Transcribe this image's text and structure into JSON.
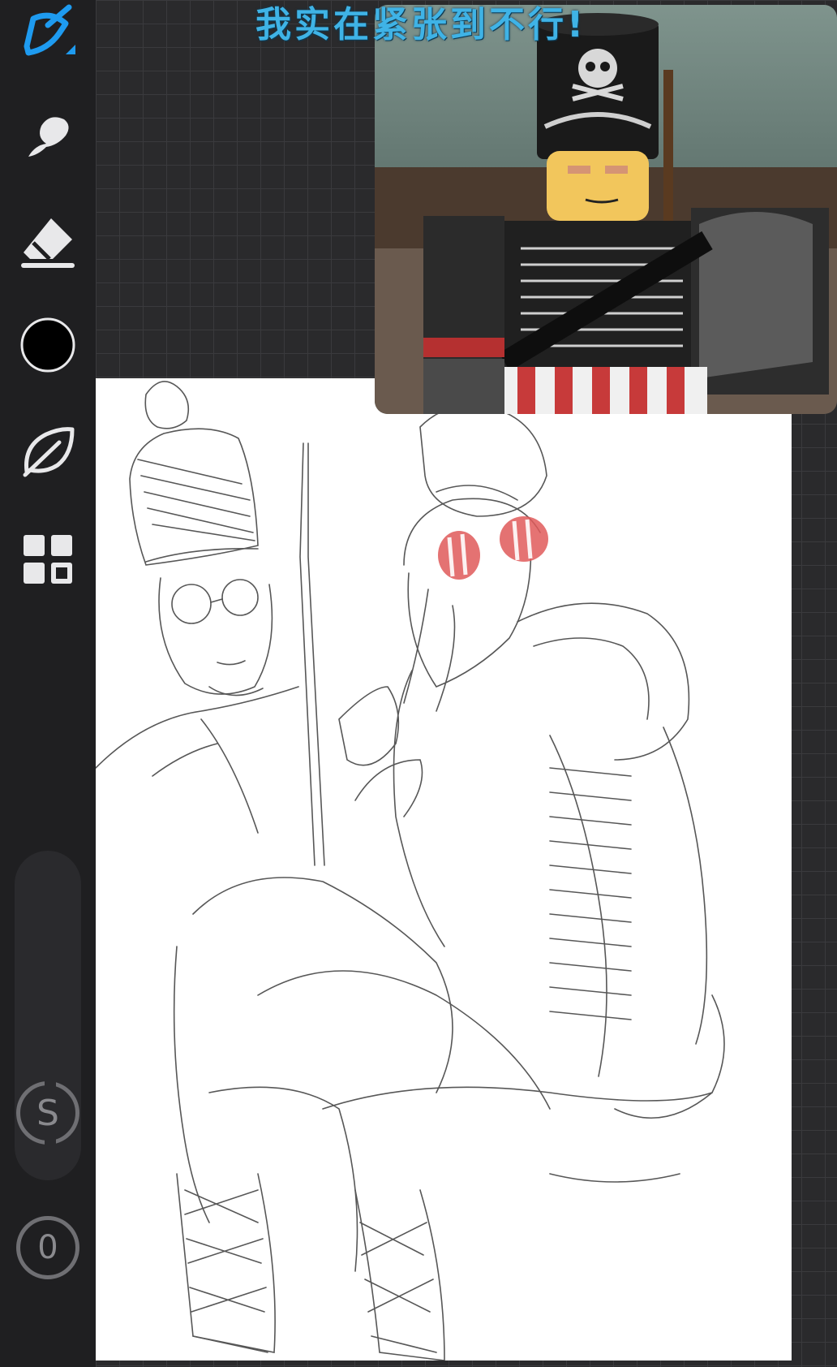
{
  "app": {
    "accent_color": "#1e9bf0",
    "current_color": "#000000"
  },
  "toolbar": {
    "tools": [
      {
        "name": "brush-tool",
        "icon": "brush-pen-icon",
        "active": true
      },
      {
        "name": "smudge-tool",
        "icon": "smudge-icon",
        "active": false
      },
      {
        "name": "eraser-tool",
        "icon": "eraser-icon",
        "active": false
      },
      {
        "name": "color-picker",
        "icon": "color-swatch",
        "active": false
      },
      {
        "name": "brush-library",
        "icon": "leaf-icon",
        "active": false
      },
      {
        "name": "layers",
        "icon": "layers-grid-icon",
        "active": false
      }
    ],
    "smudge_label": "S",
    "counter_label": "0"
  },
  "reference": {
    "caption": "我实在紧张到不行!"
  }
}
